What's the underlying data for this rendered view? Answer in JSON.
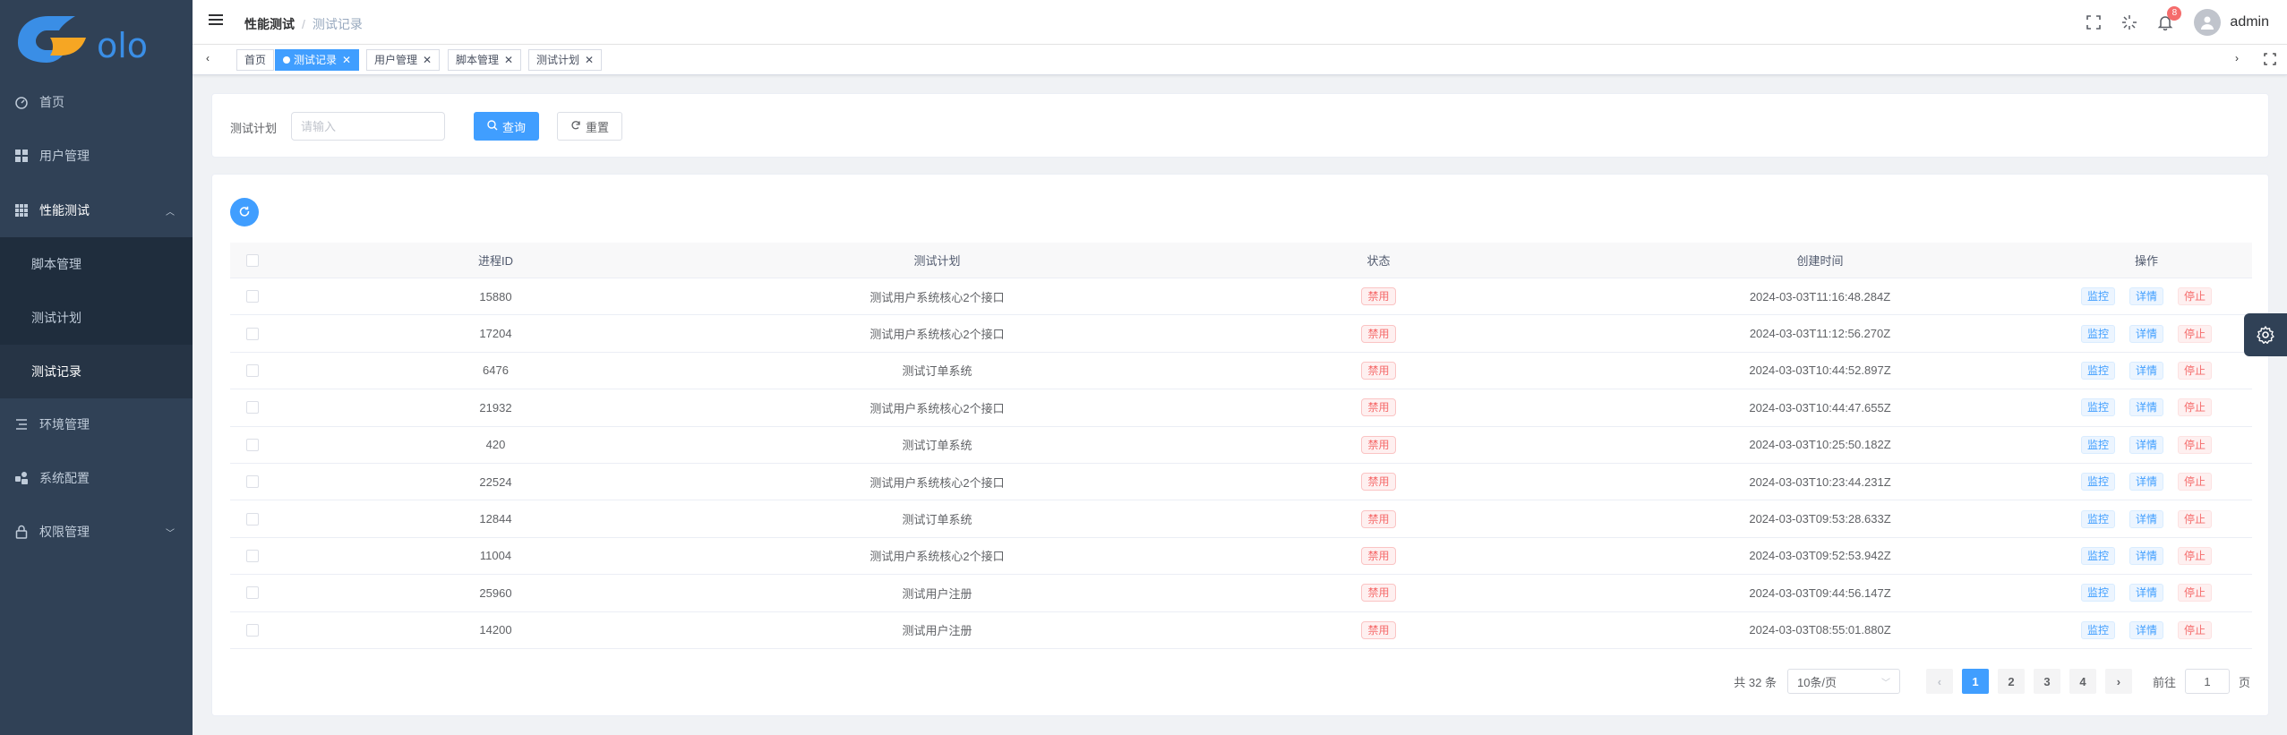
{
  "sidebar": {
    "logo_text": "olo",
    "items": [
      {
        "label": "首页"
      },
      {
        "label": "用户管理"
      },
      {
        "label": "性能测试"
      },
      {
        "label": "环境管理"
      },
      {
        "label": "系统配置"
      },
      {
        "label": "权限管理"
      }
    ],
    "submenu": [
      {
        "label": "脚本管理"
      },
      {
        "label": "测试计划"
      },
      {
        "label": "测试记录"
      }
    ]
  },
  "navbar": {
    "breadcrumb": [
      "性能测试",
      "测试记录"
    ],
    "notification_count": "8",
    "username": "admin"
  },
  "tags": [
    {
      "label": "首页"
    },
    {
      "label": "测试记录"
    },
    {
      "label": "用户管理"
    },
    {
      "label": "脚本管理"
    },
    {
      "label": "测试计划"
    }
  ],
  "search": {
    "label": "测试计划",
    "placeholder": "请输入",
    "query_label": "查询",
    "reset_label": "重置"
  },
  "table": {
    "headers": [
      "进程ID",
      "测试计划",
      "状态",
      "创建时间",
      "操作"
    ],
    "rows": [
      {
        "pid": "15880",
        "plan": "测试用户系统核心2个接口",
        "status": "禁用",
        "time": "2024-03-03T11:16:48.284Z"
      },
      {
        "pid": "17204",
        "plan": "测试用户系统核心2个接口",
        "status": "禁用",
        "time": "2024-03-03T11:12:56.270Z"
      },
      {
        "pid": "6476",
        "plan": "测试订单系统",
        "status": "禁用",
        "time": "2024-03-03T10:44:52.897Z"
      },
      {
        "pid": "21932",
        "plan": "测试用户系统核心2个接口",
        "status": "禁用",
        "time": "2024-03-03T10:44:47.655Z"
      },
      {
        "pid": "420",
        "plan": "测试订单系统",
        "status": "禁用",
        "time": "2024-03-03T10:25:50.182Z"
      },
      {
        "pid": "22524",
        "plan": "测试用户系统核心2个接口",
        "status": "禁用",
        "time": "2024-03-03T10:23:44.231Z"
      },
      {
        "pid": "12844",
        "plan": "测试订单系统",
        "status": "禁用",
        "time": "2024-03-03T09:53:28.633Z"
      },
      {
        "pid": "11004",
        "plan": "测试用户系统核心2个接口",
        "status": "禁用",
        "time": "2024-03-03T09:52:53.942Z"
      },
      {
        "pid": "25960",
        "plan": "测试用户注册",
        "status": "禁用",
        "time": "2024-03-03T09:44:56.147Z"
      },
      {
        "pid": "14200",
        "plan": "测试用户注册",
        "status": "禁用",
        "time": "2024-03-03T08:55:01.880Z"
      }
    ],
    "ops": [
      "监控",
      "详情",
      "停止"
    ]
  },
  "pagination": {
    "total": "共 32 条",
    "page_size": "10条/页",
    "pages": [
      "1",
      "2",
      "3",
      "4"
    ],
    "goto_label": "前往",
    "goto_value": "1",
    "page_suffix": "页"
  },
  "colors": {
    "sidebar_bg": "#304156",
    "primary": "#409eff",
    "danger": "#f56c6c"
  }
}
